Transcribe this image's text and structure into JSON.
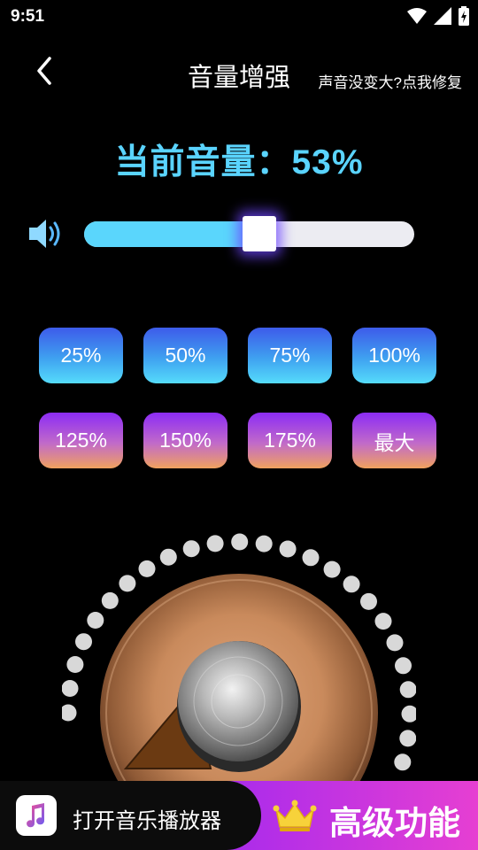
{
  "status": {
    "time": "9:51",
    "icons": [
      "wifi-icon",
      "signal-icon",
      "battery-charging-icon"
    ]
  },
  "header": {
    "back_icon": "chevron-left-icon",
    "title": "音量增强",
    "repair_link": "声音没变大?点我修复"
  },
  "volume": {
    "readout": "当前音量：53%",
    "level": 53,
    "slider_fill_color": "#5ad6fc",
    "track_color": "#ececf2",
    "speaker_icon": "speaker-icon"
  },
  "presets": {
    "row1": [
      "25%",
      "50%",
      "75%",
      "100%"
    ],
    "row2": [
      "125%",
      "150%",
      "175%",
      "最大"
    ],
    "row1_colors": [
      "#3d5bea",
      "#55dcfb"
    ],
    "row2_colors": [
      "#8c2cf5",
      "#f0a25e"
    ]
  },
  "knob": {
    "icon": "volume-knob",
    "dot_color": "#d8d8d8",
    "dial_color": "#c98a5c"
  },
  "bottom": {
    "player_icon": "music-note-icon",
    "player_label": "打开音乐播放器",
    "premium_icon": "crown-icon",
    "premium_label": "高级功能"
  }
}
